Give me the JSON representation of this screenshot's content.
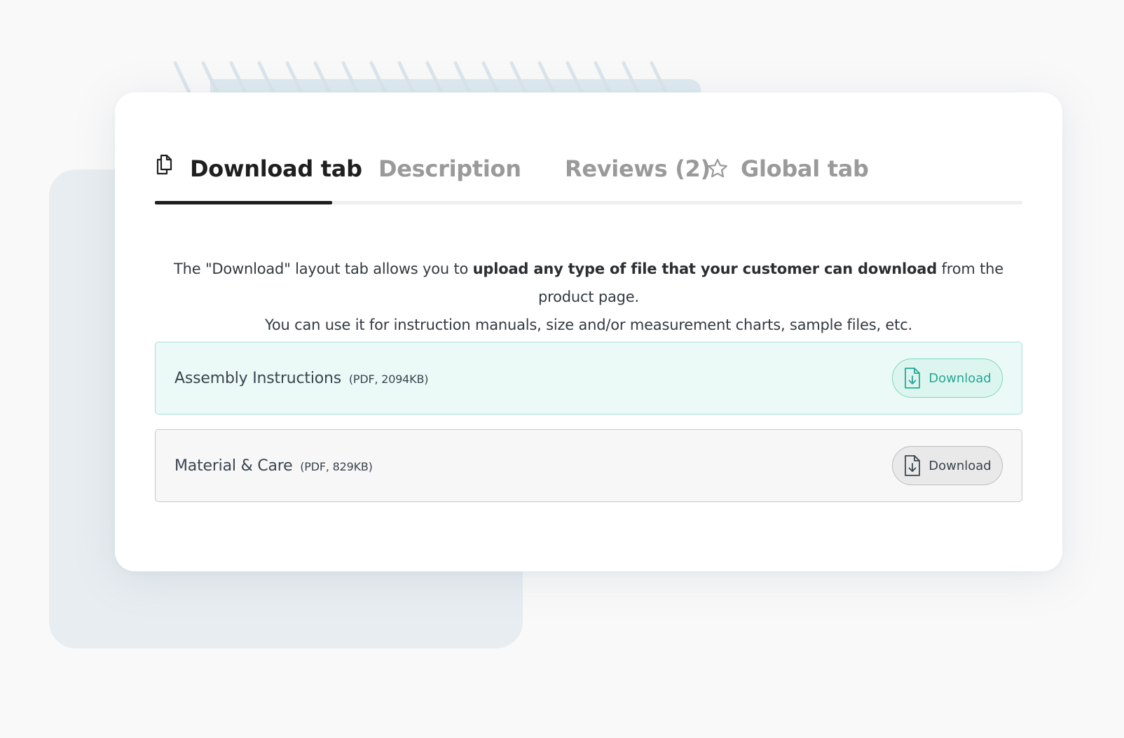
{
  "tabs": [
    {
      "label": "Download tab",
      "icon": "file-copy-icon",
      "active": true
    },
    {
      "label": "Description",
      "active": false
    },
    {
      "label": "Reviews (2)",
      "active": false
    },
    {
      "label": "Global tab",
      "icon": "star-outline-icon",
      "active": false
    }
  ],
  "intro": {
    "part1": "The \"Download\" layout tab allows you to ",
    "bold": "upload any type of file that your customer can download",
    "part2": " from the product page.",
    "line2": "You can use it for instruction manuals, size and/or measurement charts, sample files, etc."
  },
  "files": [
    {
      "name": "Assembly Instructions",
      "meta": "(PDF, 2094KB)",
      "button_label": "Download",
      "icon": "file-download-icon",
      "accent": "#2aa597"
    },
    {
      "name": "Material & Care",
      "meta": "(PDF, 829KB)",
      "button_label": "Download",
      "icon": "file-download-icon",
      "accent": "#3a4450"
    }
  ],
  "colors": {
    "active_tab": "#1f1f1f",
    "inactive_tab": "#9a9a9a",
    "teal_accent": "#2aa597",
    "teal_bg": "#ebfaf6"
  }
}
